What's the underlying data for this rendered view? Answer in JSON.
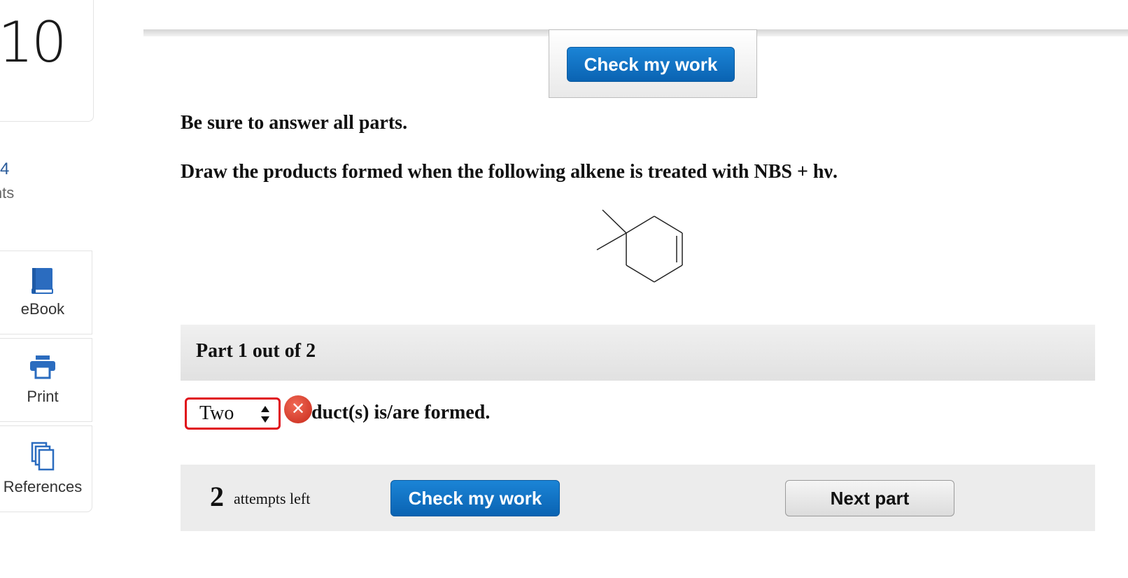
{
  "sidebar": {
    "question_number": "10",
    "points_value": "4",
    "points_label": "ints",
    "tools": [
      {
        "label": "eBook",
        "icon": "book-icon"
      },
      {
        "label": "Print",
        "icon": "printer-icon"
      },
      {
        "label": "References",
        "icon": "references-icon"
      }
    ]
  },
  "header": {
    "check_button": "Check my work"
  },
  "question": {
    "instruction": "Be sure to answer all parts.",
    "prompt": "Draw the products formed when the following alkene is treated with NBS + hν."
  },
  "part": {
    "title": "Part 1 out of 2",
    "select_value": "Two",
    "error_icon": "x-icon",
    "answer_suffix": "duct(s) is/are formed."
  },
  "footer": {
    "attempts_number": "2",
    "attempts_label": "attempts left",
    "check_button": "Check my work",
    "next_button": "Next part"
  },
  "colors": {
    "primary_button": "#0a63b2",
    "error_border": "#e0101a",
    "error_icon": "#d0392b"
  }
}
